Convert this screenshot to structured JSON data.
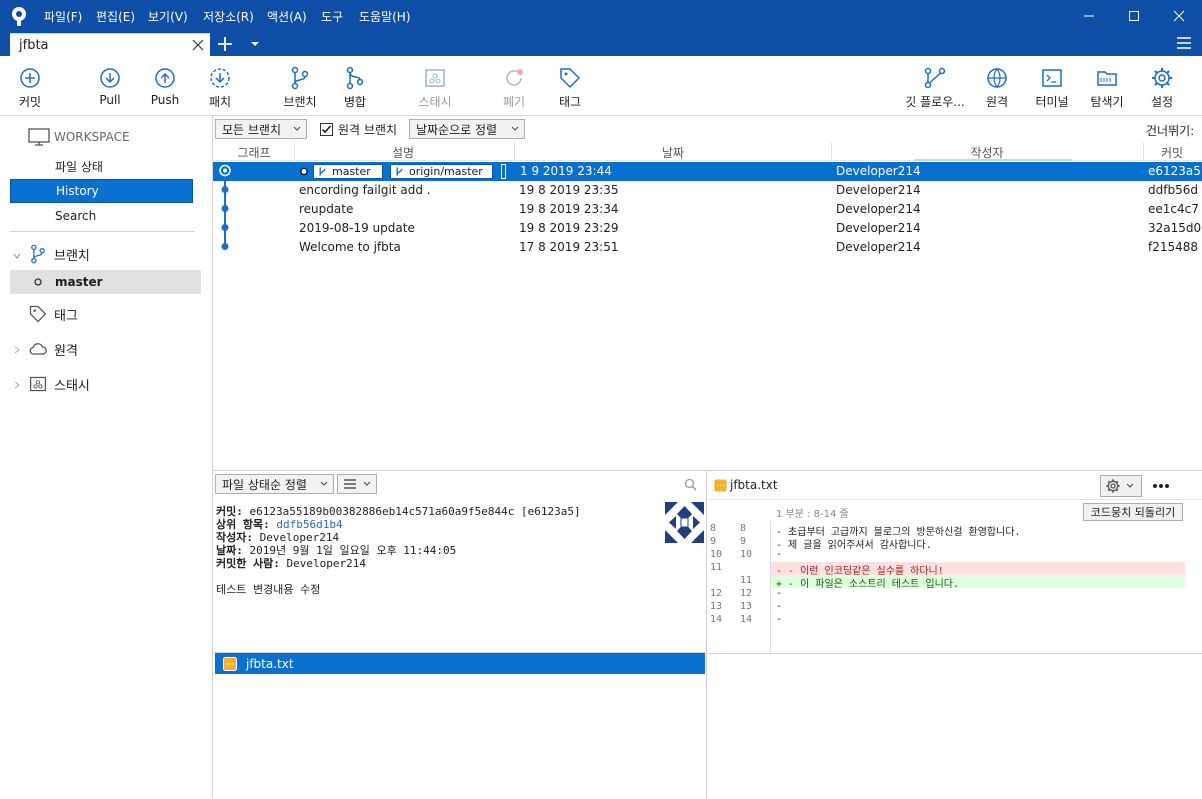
{
  "window": {
    "menu": [
      "파일(F)",
      "편집(E)",
      "보기(V)",
      "저장소(R)",
      "액션(A)",
      "도구",
      "도움말(H)"
    ],
    "tab_label": "jfbta"
  },
  "toolbar": {
    "commit": "커밋",
    "pull": "Pull",
    "push": "Push",
    "patch": "패치",
    "branch": "브랜치",
    "merge": "병합",
    "stash": "스태시",
    "discard": "폐기",
    "tag": "태그",
    "git_flow": "깃 플로우...",
    "remote": "원격",
    "terminal": "터미널",
    "explorer": "탐색기",
    "settings": "설정"
  },
  "sidebar": {
    "workspace_label": "WORKSPACE",
    "workspace_items": [
      "파일 상태",
      "History",
      "Search"
    ],
    "selected_workspace": "History",
    "branches_label": "브랜치",
    "branch_current": "master",
    "tags_label": "태그",
    "remotes_label": "원격",
    "stashes_label": "스태시"
  },
  "history_toolbar": {
    "branch_filter": "모든 브랜치",
    "remote_branch_checkbox_label": "원격 브랜치",
    "remote_branch_checked": true,
    "sort": "날짜순으로 정렬",
    "jump_label": "건너뛰기:"
  },
  "columns": [
    "그래프",
    "설명",
    "날짜",
    "작성자",
    "커밋"
  ],
  "commits": [
    {
      "desc": "",
      "date": "1 9 2019 23:44",
      "author": "Developer214",
      "hash": "e6123a5",
      "badges": [
        "master",
        "origin/master"
      ]
    },
    {
      "desc": "encording failgit add .",
      "date": "19 8 2019 23:35",
      "author": "Developer214",
      "hash": "ddfb56d"
    },
    {
      "desc": "reupdate",
      "date": "19 8 2019 23:34",
      "author": "Developer214",
      "hash": "ee1c4c7"
    },
    {
      "desc": "2019-08-19 update",
      "date": "19 8 2019 23:29",
      "author": "Developer214",
      "hash": "32a15d0"
    },
    {
      "desc": "Welcome to jfbta",
      "date": "17 8 2019 23:51",
      "author": "Developer214",
      "hash": "f215488"
    }
  ],
  "file_pane": {
    "sort_label": "파일 상태순 정렬",
    "commit_label": "커밋:",
    "commit_value": "e6123a55189b00382886eb14c571a60a9f5e844c [e6123a5]",
    "parent_label": "상위 항목:",
    "parent_value": "ddfb56d1b4",
    "author_label": "작성자:",
    "author_value": "Developer214",
    "date_label": "날짜:",
    "date_value": "2019년 9월 1일 일요일 오후 11:44:05",
    "committer_label": "커밋한 사람:",
    "committer_value": "Developer214",
    "message": "테스트 변경내용 수정",
    "files": [
      "jfbta.txt"
    ]
  },
  "diff_pane": {
    "filename": "jfbta.txt",
    "hunk_label": "1 부분 : 8-14 줄",
    "revert_button": "코드뭉치 되돌리기",
    "lines": [
      {
        "old": "8",
        "new": "8",
        "text": "  - 초급부터 고급까지 블로그의 방문하신걸 환영합니다.",
        "type": "ctx"
      },
      {
        "old": "9",
        "new": "9",
        "text": "  - 제 글을 읽어주셔서 감사합니다.",
        "type": "ctx"
      },
      {
        "old": "10",
        "new": "10",
        "text": "  -",
        "type": "ctx"
      },
      {
        "old": "11",
        "new": "",
        "text": "- - 이런 인코딩같은 실수를 하다니!",
        "type": "del"
      },
      {
        "old": "",
        "new": "11",
        "text": "+ - 이 파일은 소스트리 테스트 입니다.",
        "type": "add"
      },
      {
        "old": "12",
        "new": "12",
        "text": "  -",
        "type": "ctx"
      },
      {
        "old": "13",
        "new": "13",
        "text": "  -",
        "type": "ctx"
      },
      {
        "old": "14",
        "new": "14",
        "text": "  -",
        "type": "ctx"
      }
    ]
  },
  "colors": {
    "accent": "#0f4ea6",
    "selection": "#0a70d0",
    "graph": "#1c6ecb",
    "del_bg": "#ffe0e0",
    "add_bg": "#ddffdd"
  }
}
